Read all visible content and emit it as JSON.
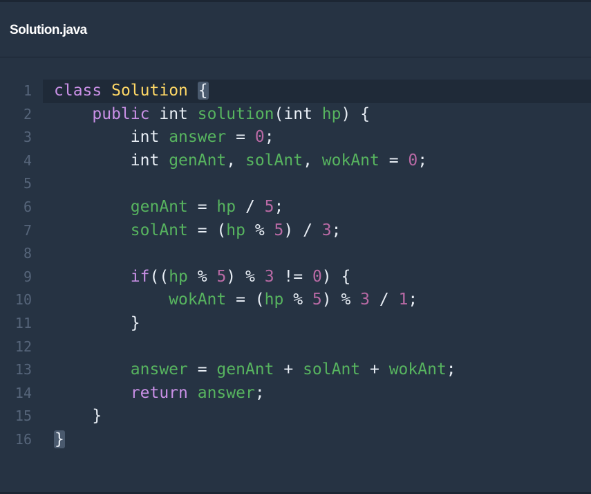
{
  "tab": {
    "filename": "Solution.java"
  },
  "lines": [
    {
      "n": "1",
      "tokens": [
        {
          "t": "class",
          "c": "kw"
        },
        {
          "t": " ",
          "c": "op"
        },
        {
          "t": "Solution",
          "c": "cls"
        },
        {
          "t": " ",
          "c": "op"
        },
        {
          "t": "{",
          "c": "op",
          "hl": true
        }
      ]
    },
    {
      "n": "2",
      "tokens": [
        {
          "t": "    ",
          "c": "op"
        },
        {
          "t": "public",
          "c": "kw"
        },
        {
          "t": " ",
          "c": "op"
        },
        {
          "t": "int",
          "c": "ty"
        },
        {
          "t": " ",
          "c": "op"
        },
        {
          "t": "solution",
          "c": "id"
        },
        {
          "t": "(",
          "c": "op"
        },
        {
          "t": "int",
          "c": "ty"
        },
        {
          "t": " ",
          "c": "op"
        },
        {
          "t": "hp",
          "c": "id"
        },
        {
          "t": ") {",
          "c": "op"
        }
      ]
    },
    {
      "n": "3",
      "tokens": [
        {
          "t": "        ",
          "c": "op"
        },
        {
          "t": "int",
          "c": "ty"
        },
        {
          "t": " ",
          "c": "op"
        },
        {
          "t": "answer",
          "c": "id"
        },
        {
          "t": " = ",
          "c": "op"
        },
        {
          "t": "0",
          "c": "num"
        },
        {
          "t": ";",
          "c": "op"
        }
      ]
    },
    {
      "n": "4",
      "tokens": [
        {
          "t": "        ",
          "c": "op"
        },
        {
          "t": "int",
          "c": "ty"
        },
        {
          "t": " ",
          "c": "op"
        },
        {
          "t": "genAnt",
          "c": "id"
        },
        {
          "t": ", ",
          "c": "op"
        },
        {
          "t": "solAnt",
          "c": "id"
        },
        {
          "t": ", ",
          "c": "op"
        },
        {
          "t": "wokAnt",
          "c": "id"
        },
        {
          "t": " = ",
          "c": "op"
        },
        {
          "t": "0",
          "c": "num"
        },
        {
          "t": ";",
          "c": "op"
        }
      ]
    },
    {
      "n": "5",
      "tokens": []
    },
    {
      "n": "6",
      "tokens": [
        {
          "t": "        ",
          "c": "op"
        },
        {
          "t": "genAnt",
          "c": "id"
        },
        {
          "t": " = ",
          "c": "op"
        },
        {
          "t": "hp",
          "c": "id"
        },
        {
          "t": " / ",
          "c": "op"
        },
        {
          "t": "5",
          "c": "num"
        },
        {
          "t": ";",
          "c": "op"
        }
      ]
    },
    {
      "n": "7",
      "tokens": [
        {
          "t": "        ",
          "c": "op"
        },
        {
          "t": "solAnt",
          "c": "id"
        },
        {
          "t": " = (",
          "c": "op"
        },
        {
          "t": "hp",
          "c": "id"
        },
        {
          "t": " % ",
          "c": "op"
        },
        {
          "t": "5",
          "c": "num"
        },
        {
          "t": ") / ",
          "c": "op"
        },
        {
          "t": "3",
          "c": "num"
        },
        {
          "t": ";",
          "c": "op"
        }
      ]
    },
    {
      "n": "8",
      "tokens": []
    },
    {
      "n": "9",
      "tokens": [
        {
          "t": "        ",
          "c": "op"
        },
        {
          "t": "if",
          "c": "kw"
        },
        {
          "t": "((",
          "c": "op"
        },
        {
          "t": "hp",
          "c": "id"
        },
        {
          "t": " % ",
          "c": "op"
        },
        {
          "t": "5",
          "c": "num"
        },
        {
          "t": ") % ",
          "c": "op"
        },
        {
          "t": "3",
          "c": "num"
        },
        {
          "t": " != ",
          "c": "op"
        },
        {
          "t": "0",
          "c": "num"
        },
        {
          "t": ") {",
          "c": "op"
        }
      ]
    },
    {
      "n": "10",
      "tokens": [
        {
          "t": "            ",
          "c": "op"
        },
        {
          "t": "wokAnt",
          "c": "id"
        },
        {
          "t": " = (",
          "c": "op"
        },
        {
          "t": "hp",
          "c": "id"
        },
        {
          "t": " % ",
          "c": "op"
        },
        {
          "t": "5",
          "c": "num"
        },
        {
          "t": ") % ",
          "c": "op"
        },
        {
          "t": "3",
          "c": "num"
        },
        {
          "t": " / ",
          "c": "op"
        },
        {
          "t": "1",
          "c": "num"
        },
        {
          "t": ";",
          "c": "op"
        }
      ]
    },
    {
      "n": "11",
      "tokens": [
        {
          "t": "        ",
          "c": "op"
        },
        {
          "t": "}",
          "c": "op"
        }
      ]
    },
    {
      "n": "12",
      "tokens": []
    },
    {
      "n": "13",
      "tokens": [
        {
          "t": "        ",
          "c": "op"
        },
        {
          "t": "answer",
          "c": "id"
        },
        {
          "t": " = ",
          "c": "op"
        },
        {
          "t": "genAnt",
          "c": "id"
        },
        {
          "t": " + ",
          "c": "op"
        },
        {
          "t": "solAnt",
          "c": "id"
        },
        {
          "t": " + ",
          "c": "op"
        },
        {
          "t": "wokAnt",
          "c": "id"
        },
        {
          "t": ";",
          "c": "op"
        }
      ]
    },
    {
      "n": "14",
      "tokens": [
        {
          "t": "        ",
          "c": "op"
        },
        {
          "t": "return",
          "c": "kw"
        },
        {
          "t": " ",
          "c": "op"
        },
        {
          "t": "answer",
          "c": "id"
        },
        {
          "t": ";",
          "c": "op"
        }
      ]
    },
    {
      "n": "15",
      "tokens": [
        {
          "t": "    ",
          "c": "op"
        },
        {
          "t": "}",
          "c": "op"
        }
      ]
    },
    {
      "n": "16",
      "tokens": [
        {
          "t": "}",
          "c": "op",
          "hl": true
        }
      ]
    }
  ],
  "active_line": "1",
  "colors": {
    "background": "#263343",
    "keyword": "#c990e6",
    "class_name": "#ffd866",
    "identifier": "#57b45f",
    "number": "#b96aa5",
    "text": "#e8eef5",
    "line_number": "#56657a"
  }
}
